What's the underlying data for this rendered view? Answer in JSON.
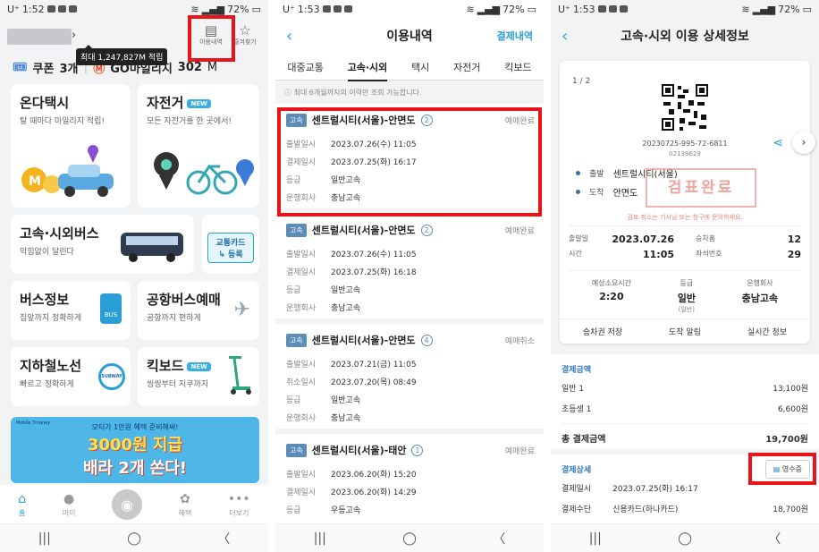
{
  "phone1": {
    "status": {
      "carrier": "U⁺",
      "time": "1:52",
      "battery": "72%"
    },
    "tooltip": "최대 1,247,827M 적립",
    "top_icons": [
      {
        "label": "이용내역",
        "icon": "receipt-icon"
      },
      {
        "label": "즐겨찾기",
        "icon": "star-icon"
      }
    ],
    "coupon_label": "쿠폰",
    "coupon_count": "3개",
    "mileage_label": "GO마일리지",
    "mileage_value": "302",
    "mileage_unit": "M",
    "tiles": [
      {
        "title": "온다택시",
        "sub": "탈 때마다 마일리지 적립!"
      },
      {
        "title": "자전거",
        "badge": "NEW",
        "sub": "모든 자전거를 한 곳에서!"
      },
      {
        "title": "고속·시외버스",
        "sub": "막힘없이 달린다",
        "extra": "교통카드\n↳ 등록"
      },
      {
        "title": "버스정보",
        "sub": "집앞까지 정확하게"
      },
      {
        "title": "공항버스예매",
        "sub": "공항까지 편하게"
      },
      {
        "title": "지하철노선",
        "sub": "빠르고 정확하게",
        "extra": "SUBWAY"
      },
      {
        "title": "킥보드",
        "badge": "NEW",
        "sub": "씽씽부터 지쿠까지"
      }
    ],
    "banner": {
      "top": "모티가 1만원 혜택 준비해써!",
      "line1": "3000원 지급",
      "line2": "배라 2개 쏜다!",
      "brand": "Mobile Tmoney"
    },
    "tabbar": [
      {
        "label": "홈"
      },
      {
        "label": "마이"
      },
      {
        "label": ""
      },
      {
        "label": "혜택"
      },
      {
        "label": "더보기"
      }
    ]
  },
  "phone2": {
    "status": {
      "carrier": "U⁺",
      "time": "1:53",
      "battery": "72%"
    },
    "title": "이용내역",
    "action": "결제내역",
    "tabs": [
      "대중교통",
      "고속·시외",
      "택시",
      "자전거",
      "킥보드"
    ],
    "active_tab": "고속·시외",
    "notice": "ⓘ 최대 6개월까지의 이력만 조회 가능합니다.",
    "trips": [
      {
        "badge": "고속",
        "route": "센트럴시티(서울)-안면도",
        "count": "2",
        "status": "예매완료",
        "rows": [
          {
            "k": "출발일시",
            "v": "2023.07.26(수) 11:05"
          },
          {
            "k": "결제일시",
            "v": "2023.07.25(화) 16:17"
          },
          {
            "k": "등급",
            "v": "일반고속"
          },
          {
            "k": "운행회사",
            "v": "충남고속"
          }
        ]
      },
      {
        "badge": "고속",
        "route": "센트럴시티(서울)-안면도",
        "count": "2",
        "status": "예매완료",
        "rows": [
          {
            "k": "출발일시",
            "v": "2023.07.26(수) 11:05"
          },
          {
            "k": "결제일시",
            "v": "2023.07.25(화) 16:18"
          },
          {
            "k": "등급",
            "v": "일반고속"
          },
          {
            "k": "운행회사",
            "v": "충남고속"
          }
        ]
      },
      {
        "badge": "고속",
        "route": "센트럴시티(서울)-안면도",
        "count": "4",
        "status": "예매취소",
        "rows": [
          {
            "k": "출발일시",
            "v": "2023.07.21(금) 11:05"
          },
          {
            "k": "취소일시",
            "v": "2023.07.20(목) 08:49"
          },
          {
            "k": "등급",
            "v": "일반고속"
          },
          {
            "k": "운행회사",
            "v": "충남고속"
          }
        ]
      },
      {
        "badge": "고속",
        "route": "센트럴시티(서울)-태안",
        "count": "1",
        "status": "예매완료",
        "rows": [
          {
            "k": "출발일시",
            "v": "2023.06.20(화) 15:20"
          },
          {
            "k": "결제일시",
            "v": "2023.06.20(화) 14:29"
          },
          {
            "k": "등급",
            "v": "우등고속"
          }
        ]
      }
    ]
  },
  "phone3": {
    "status": {
      "carrier": "U⁺",
      "time": "1:53",
      "battery": "72%"
    },
    "title": "고속·시외 이용 상세정보",
    "pager": "1 / 2",
    "ticket_no": "20230725-995-72-6811",
    "ticket_sub": "02139629",
    "departure_label": "출발",
    "departure": "센트럴시티(서울)",
    "arrival_label": "도착",
    "arrival": "안면도",
    "stamp": "검표완료",
    "stamp_note": "검표 취소는 기사님 또는 창구에 문의하세요.",
    "depart_date_label": "출발일",
    "depart_date": "2023.07.26",
    "time_label": "시간",
    "time": "11:05",
    "platform_label": "승차홈",
    "platform": "12",
    "seat_label": "좌석번호",
    "seat": "29",
    "duration_label": "예상소요시간",
    "duration": "2:20",
    "grade_label": "등급",
    "grade": "일반",
    "grade_sub": "(일반)",
    "company_label": "운행회사",
    "company": "충남고속",
    "card_buttons": [
      "승차권 저장",
      "도착 알림",
      "실시간 정보"
    ],
    "pay_title": "결제금액",
    "pay_rows": [
      {
        "k": "일반 1",
        "v": "13,100원"
      },
      {
        "k": "초등생 1",
        "v": "6,600원"
      }
    ],
    "total_label": "총 결제금액",
    "total": "19,700원",
    "detail_title": "결제상세",
    "receipt": "영수증",
    "detail_rows": [
      {
        "k": "결제일시",
        "v": "2023.07.25(화) 16:17"
      },
      {
        "k": "결제수단",
        "v": "신용카드(하나카드)",
        "amt": "18,700원"
      }
    ]
  },
  "colors": {
    "accent": "#2a9fd6",
    "highlight": "#e8141b",
    "badge": "#5b8db8"
  }
}
